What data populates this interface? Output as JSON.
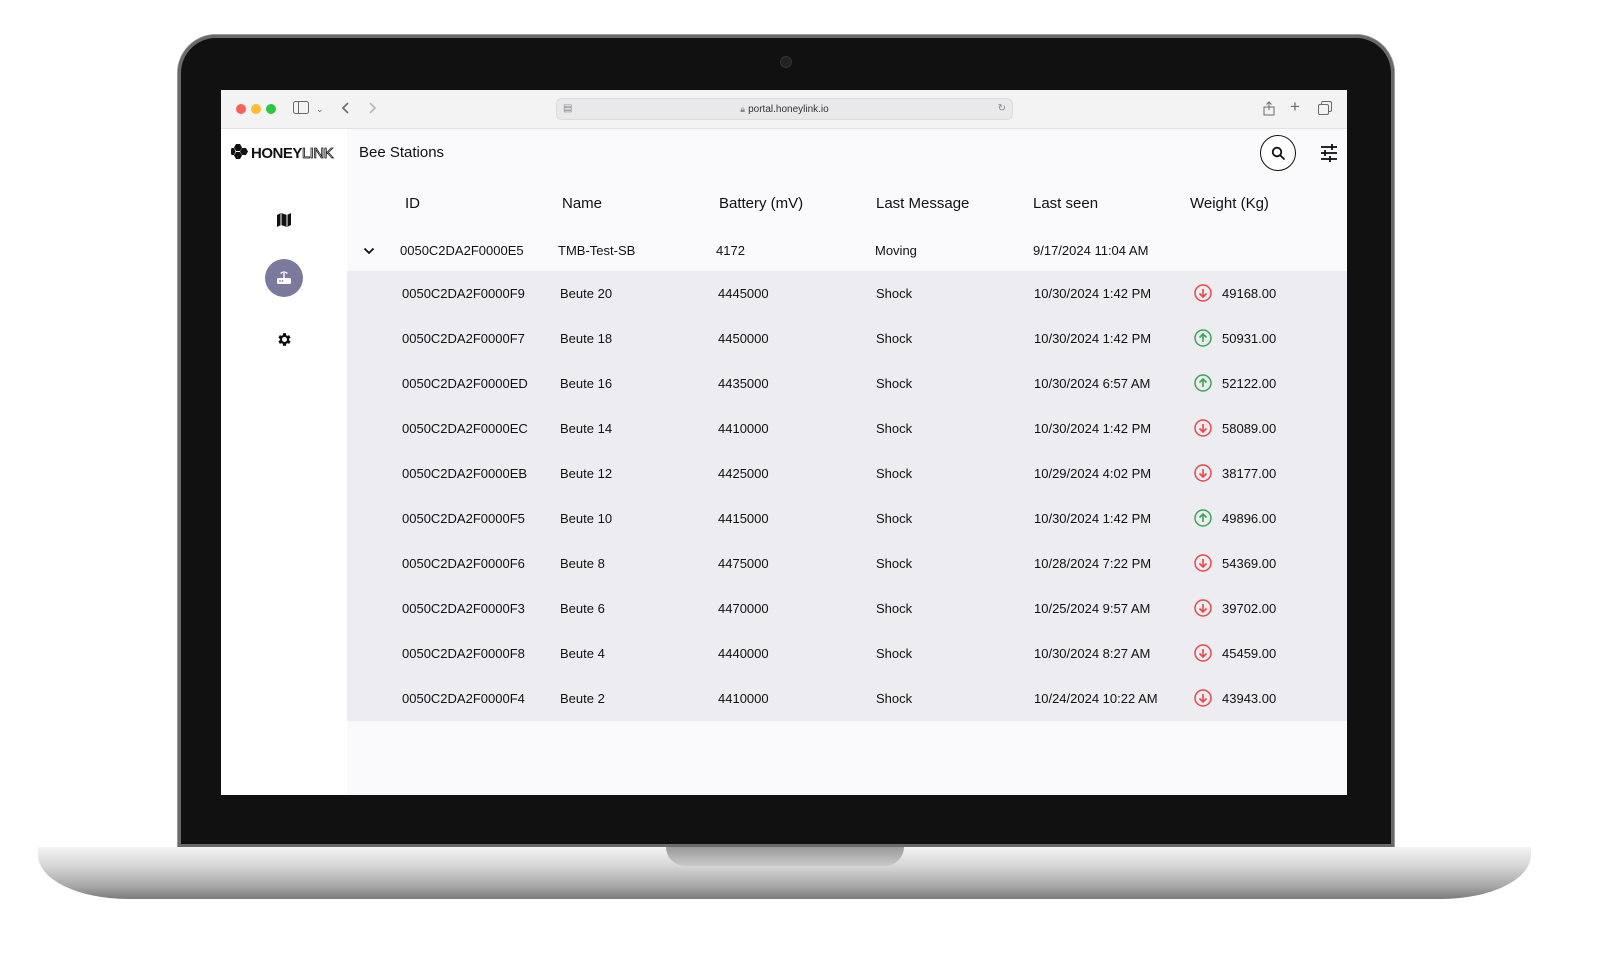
{
  "browser": {
    "url": "portal.honeylink.io"
  },
  "app": {
    "logo_bold": "HONEY",
    "logo_outline": "LINK",
    "page_title": "Bee Stations"
  },
  "sidebar": {
    "items": [
      {
        "icon": "map-icon"
      },
      {
        "icon": "router-icon",
        "active": true
      },
      {
        "icon": "gear-icon"
      }
    ]
  },
  "table": {
    "headers": [
      "ID",
      "Name",
      "Battery (mV)",
      "Last Message",
      "Last seen",
      "Weight (Kg)"
    ],
    "parent": {
      "id": "0050C2DA2F0000E5",
      "name": "TMB-Test-SB",
      "battery": "4172",
      "last_message": "Moving",
      "last_seen": "9/17/2024 11:04 AM",
      "weight": ""
    },
    "rows": [
      {
        "id": "0050C2DA2F0000F9",
        "name": "Beute 20",
        "battery": "4445000",
        "last_message": "Shock",
        "last_seen": "10/30/2024 1:42 PM",
        "trend": "down",
        "weight": "49168.00"
      },
      {
        "id": "0050C2DA2F0000F7",
        "name": "Beute 18",
        "battery": "4450000",
        "last_message": "Shock",
        "last_seen": "10/30/2024 1:42 PM",
        "trend": "up",
        "weight": "50931.00"
      },
      {
        "id": "0050C2DA2F0000ED",
        "name": "Beute 16",
        "battery": "4435000",
        "last_message": "Shock",
        "last_seen": "10/30/2024 6:57 AM",
        "trend": "up",
        "weight": "52122.00"
      },
      {
        "id": "0050C2DA2F0000EC",
        "name": "Beute 14",
        "battery": "4410000",
        "last_message": "Shock",
        "last_seen": "10/30/2024 1:42 PM",
        "trend": "down",
        "weight": "58089.00"
      },
      {
        "id": "0050C2DA2F0000EB",
        "name": "Beute 12",
        "battery": "4425000",
        "last_message": "Shock",
        "last_seen": "10/29/2024 4:02 PM",
        "trend": "down",
        "weight": "38177.00"
      },
      {
        "id": "0050C2DA2F0000F5",
        "name": "Beute 10",
        "battery": "4415000",
        "last_message": "Shock",
        "last_seen": "10/30/2024 1:42 PM",
        "trend": "up",
        "weight": "49896.00"
      },
      {
        "id": "0050C2DA2F0000F6",
        "name": "Beute 8",
        "battery": "4475000",
        "last_message": "Shock",
        "last_seen": "10/28/2024 7:22 PM",
        "trend": "down",
        "weight": "54369.00"
      },
      {
        "id": "0050C2DA2F0000F3",
        "name": "Beute 6",
        "battery": "4470000",
        "last_message": "Shock",
        "last_seen": "10/25/2024 9:57 AM",
        "trend": "down",
        "weight": "39702.00"
      },
      {
        "id": "0050C2DA2F0000F8",
        "name": "Beute 4",
        "battery": "4440000",
        "last_message": "Shock",
        "last_seen": "10/30/2024 8:27 AM",
        "trend": "down",
        "weight": "45459.00"
      },
      {
        "id": "0050C2DA2F0000F4",
        "name": "Beute 2",
        "battery": "4410000",
        "last_message": "Shock",
        "last_seen": "10/24/2024 10:22 AM",
        "trend": "down",
        "weight": "43943.00"
      }
    ]
  },
  "colors": {
    "trend_up": "#3aa655",
    "trend_down": "#e5484d",
    "active_nav": "#7c7a9c",
    "child_row_bg": "#ececf1"
  }
}
